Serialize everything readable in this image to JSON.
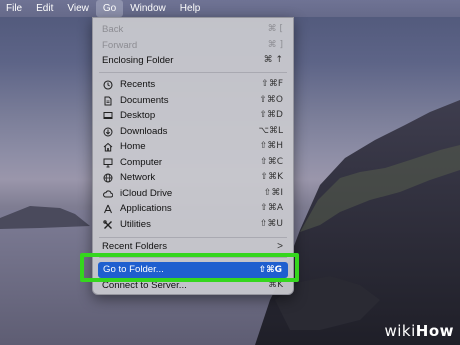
{
  "menubar": {
    "items": [
      "File",
      "Edit",
      "View",
      "Go",
      "Window",
      "Help"
    ],
    "active_index": 3
  },
  "go_menu": {
    "nav": [
      {
        "label": "Back",
        "shortcut": "⌘ [",
        "enabled": false
      },
      {
        "label": "Forward",
        "shortcut": "⌘ ]",
        "enabled": false
      },
      {
        "label": "Enclosing Folder",
        "shortcut": "⌘ ↑",
        "enabled": true
      }
    ],
    "places": [
      {
        "label": "Recents",
        "shortcut": "⇧⌘F",
        "icon": "clock-icon"
      },
      {
        "label": "Documents",
        "shortcut": "⇧⌘O",
        "icon": "document-icon"
      },
      {
        "label": "Desktop",
        "shortcut": "⇧⌘D",
        "icon": "desktop-icon"
      },
      {
        "label": "Downloads",
        "shortcut": "⌥⌘L",
        "icon": "download-icon"
      },
      {
        "label": "Home",
        "shortcut": "⇧⌘H",
        "icon": "home-icon"
      },
      {
        "label": "Computer",
        "shortcut": "⇧⌘C",
        "icon": "computer-icon"
      },
      {
        "label": "Network",
        "shortcut": "⇧⌘K",
        "icon": "network-icon"
      },
      {
        "label": "iCloud Drive",
        "shortcut": "⇧⌘I",
        "icon": "cloud-icon"
      },
      {
        "label": "Applications",
        "shortcut": "⇧⌘A",
        "icon": "applications-icon"
      },
      {
        "label": "Utilities",
        "shortcut": "⇧⌘U",
        "icon": "utilities-icon"
      }
    ],
    "recent_folders": {
      "label": "Recent Folders",
      "submenu_arrow": ">"
    },
    "go_to_folder": {
      "label": "Go to Folder...",
      "shortcut": "⇧⌘G"
    },
    "connect_to_server": {
      "label": "Connect to Server...",
      "shortcut": "⌘K"
    }
  },
  "colors": {
    "selection": "#1f5fcf",
    "highlight_box": "#35d61e"
  },
  "watermark": {
    "part1": "wiki",
    "part2": "How"
  }
}
